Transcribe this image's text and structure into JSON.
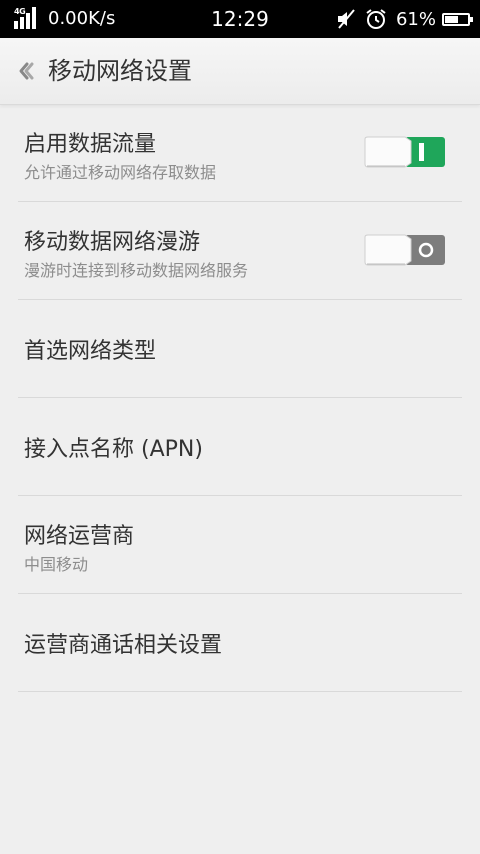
{
  "status_bar": {
    "network_type": "4G",
    "net_speed": "0.00K/s",
    "time": "12:29",
    "battery_percent": "61%",
    "battery_level": 0.61,
    "icons": [
      "signal-icon",
      "mute-icon",
      "alarm-icon",
      "battery-icon"
    ]
  },
  "header": {
    "title": "移动网络设置",
    "back_icon": "back-chevron-icon"
  },
  "settings": [
    {
      "label": "启用数据流量",
      "sub": "允许通过移动网络存取数据",
      "toggle": true
    },
    {
      "label": "移动数据网络漫游",
      "sub": "漫游时连接到移动数据网络服务",
      "toggle": false
    },
    {
      "label": "首选网络类型"
    },
    {
      "label": "接入点名称 (APN)"
    },
    {
      "label": "网络运营商",
      "sub": "中国移动"
    },
    {
      "label": "运营商通话相关设置"
    }
  ],
  "colors": {
    "toggle_on": "#1fa65a",
    "toggle_off": "#7d7d7d",
    "background": "#efefef",
    "status_bar": "#000000"
  }
}
